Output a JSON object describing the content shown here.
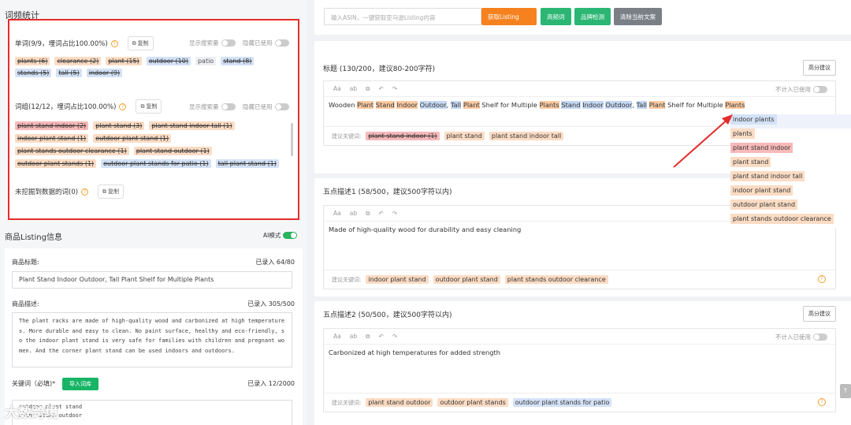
{
  "left": {
    "freq_title": "词频统计",
    "single": {
      "header": "单词(9/9，埋词占比100.00%)",
      "copy": "复制",
      "show_search": "显示搜索量",
      "hide_used": "隐藏已使用",
      "tags": [
        {
          "text": "plants (6)",
          "style": "org"
        },
        {
          "text": "clearance (2)",
          "style": "org"
        },
        {
          "text": "plant (15)",
          "style": "org"
        },
        {
          "text": "outdoor (10)",
          "style": "blu"
        },
        {
          "text": "patio",
          "style": "plain"
        },
        {
          "text": "stand (8)",
          "style": "blu"
        },
        {
          "text": "stands (5)",
          "style": "blu"
        },
        {
          "text": "tall (5)",
          "style": "blu"
        },
        {
          "text": "indoor (9)",
          "style": "blu"
        }
      ]
    },
    "phrase": {
      "header": "词组(12/12，埋词占比100.00%)",
      "copy": "复制",
      "show_search": "显示搜索量",
      "hide_used": "隐藏已使用",
      "tags": [
        {
          "text": "plant stand indoor (2)",
          "style": "red"
        },
        {
          "text": "plant stand (3)",
          "style": "org"
        },
        {
          "text": "plant stand indoor tall (1)",
          "style": "org"
        },
        {
          "text": "indoor plant stand (1)",
          "style": "org"
        },
        {
          "text": "outdoor plant stand (1)",
          "style": "org"
        },
        {
          "text": "plant stands outdoor clearance (1)",
          "style": "org"
        },
        {
          "text": "plant stand outdoor (1)",
          "style": "org"
        },
        {
          "text": "outdoor plant stands (1)",
          "style": "org"
        },
        {
          "text": "outdoor plant stands for patio (1)",
          "style": "blu"
        },
        {
          "text": "tall plant stand (1)",
          "style": "blu"
        }
      ]
    },
    "unmined": {
      "header": "未挖掘到数据的词(0)",
      "copy": "复制"
    },
    "listing": {
      "title": "商品Listing信息",
      "ai_mode": "AI模式",
      "product_title_label": "商品标题:",
      "product_title_count": "已录入 64/80",
      "product_title_value": "Plant Stand Indoor Outdoor, Tall Plant Shelf for Multiple Plants",
      "desc_label": "商品描述:",
      "desc_count": "已录入 305/500",
      "desc_lines": [
        "The plant racks are made of high-quality wood and carbonized at high temperature",
        "s. More durable and easy to clean. No paint surface, healthy and eco-friendly, s",
        "o the indoor plant stand is very safe for families with children and pregnant wo",
        "men. And the corner plant stand can be used indoors and outdoors."
      ],
      "kw_label": "关键词（必填)*",
      "kw_import": "导入词库",
      "kw_count": "已录入 12/2000",
      "kw_lines": [
        "outdoor plant stand",
        "plant stand outdoor"
      ]
    }
  },
  "top": {
    "search_placeholder": "输入ASIN，一键获取亚马逊Listing内容",
    "btn_fetch": "获取Listing",
    "btn_hot": "高频词",
    "btn_brand": "品牌检测",
    "btn_clear": "清除当前文案"
  },
  "editors": {
    "not_count_used": "不计入已使用",
    "suggest_label": "建议关键词:",
    "high_btn": "高分建议",
    "title_panel": {
      "heading": "标题 (130/200，建议80-200字符)",
      "segments": [
        {
          "t": "Wooden ",
          "c": ""
        },
        {
          "t": "Plant",
          "c": "org"
        },
        {
          "t": " ",
          "c": ""
        },
        {
          "t": "Stand",
          "c": "org"
        },
        {
          "t": " ",
          "c": ""
        },
        {
          "t": "Indoor",
          "c": "org"
        },
        {
          "t": " ",
          "c": ""
        },
        {
          "t": "Outdoor",
          "c": "blu"
        },
        {
          "t": ", ",
          "c": ""
        },
        {
          "t": "Tall",
          "c": "blu"
        },
        {
          "t": " ",
          "c": ""
        },
        {
          "t": "Plant",
          "c": "org"
        },
        {
          "t": " Shelf for Multiple ",
          "c": ""
        },
        {
          "t": "Plants",
          "c": "org"
        },
        {
          "t": " ",
          "c": ""
        },
        {
          "t": "Stand",
          "c": "blu"
        },
        {
          "t": " ",
          "c": ""
        },
        {
          "t": "Indoor",
          "c": "blu"
        },
        {
          "t": " ",
          "c": ""
        },
        {
          "t": "Outdoor",
          "c": "blu"
        },
        {
          "t": ", ",
          "c": ""
        },
        {
          "t": "Tall",
          "c": "blu"
        },
        {
          "t": " ",
          "c": ""
        },
        {
          "t": "Plant",
          "c": "org"
        },
        {
          "t": " Shelf for Multiple ",
          "c": ""
        },
        {
          "t": "Plants",
          "c": "org"
        }
      ],
      "suggest": [
        {
          "text": "plant stand indoor (1)",
          "style": "red",
          "strike": true
        },
        {
          "text": "plant stand",
          "style": "org",
          "strike": false
        },
        {
          "text": "plant stand indoor tall",
          "style": "org",
          "strike": false
        }
      ]
    },
    "bullet1": {
      "heading": "五点描述1 (58/500，建议500字符以内)",
      "text": "Made of high-quality wood for durability and easy cleaning",
      "suggest": [
        {
          "text": "indoor plant stand",
          "style": "org",
          "strike": false
        },
        {
          "text": "outdoor plant stand",
          "style": "org",
          "strike": false
        },
        {
          "text": "plant stands outdoor clearance",
          "style": "org",
          "strike": false
        }
      ]
    },
    "bullet2": {
      "heading": "五点描述2 (50/500，建议500字符以内)",
      "text": "Carbonized at high temperatures for added strength",
      "suggest": [
        {
          "text": "plant stand outdoor",
          "style": "org",
          "strike": false
        },
        {
          "text": "outdoor plant stands",
          "style": "org",
          "strike": false
        },
        {
          "text": "outdoor plant stands for patio",
          "style": "blu",
          "strike": false
        }
      ]
    }
  },
  "dropdown": [
    {
      "text": "indoor plants",
      "style": "blu"
    },
    {
      "text": "plants",
      "style": "org"
    },
    {
      "text": "plant stand indoor",
      "style": "red"
    },
    {
      "text": "plant stand",
      "style": "org"
    },
    {
      "text": "plant stand indoor tall",
      "style": "org"
    },
    {
      "text": "indoor plant stand",
      "style": "org"
    },
    {
      "text": "outdoor plant stand",
      "style": "org"
    },
    {
      "text": "plant stands outdoor clearance",
      "style": "org"
    }
  ],
  "watermark": "大数跨境",
  "colors": {
    "accent_orange": "#f5821f",
    "green": "#2bb673",
    "gray_btn": "#7a7f86",
    "highlight_box": "#e52d2d"
  }
}
